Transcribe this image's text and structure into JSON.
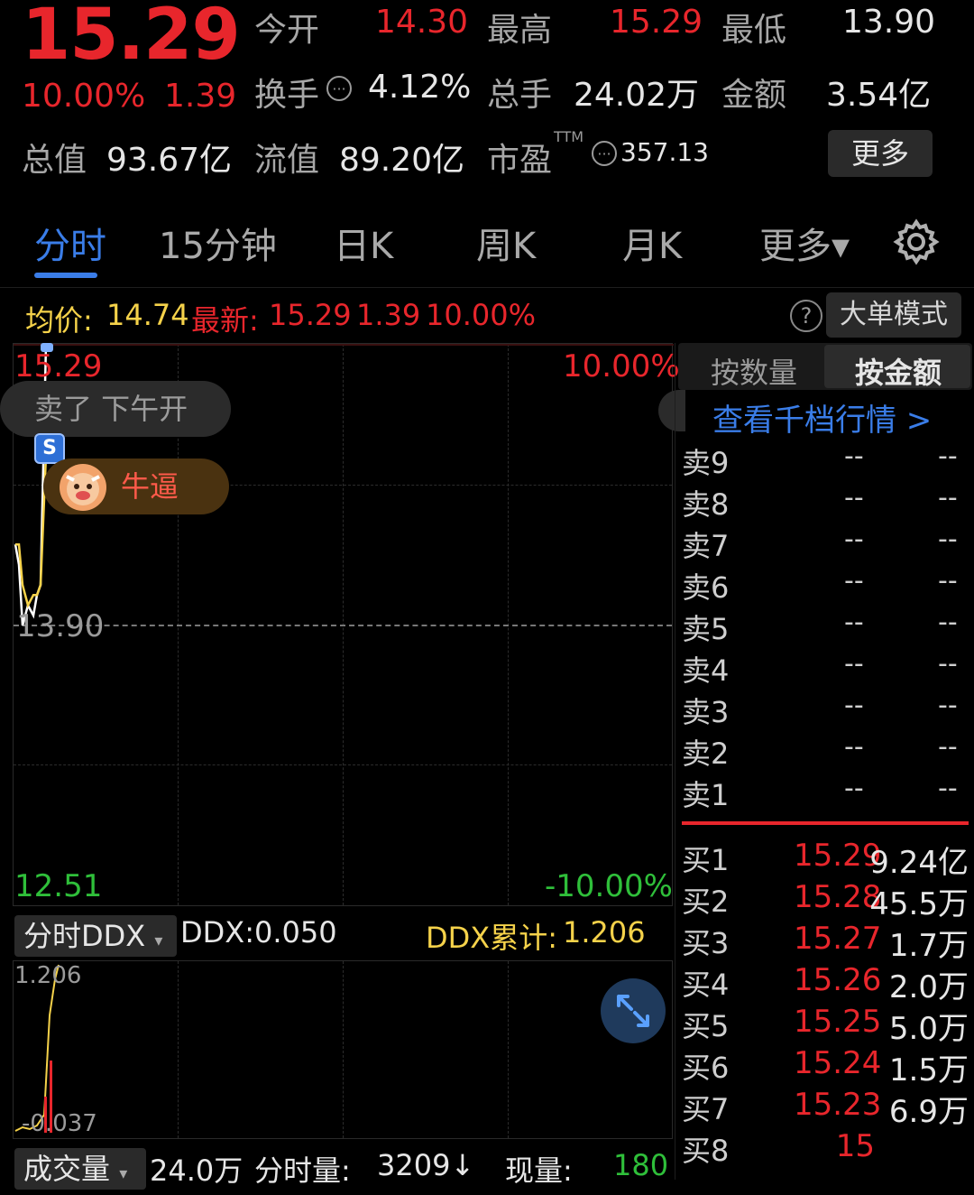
{
  "quote": {
    "price": "15.29",
    "change_pct": "10.00%",
    "change": "1.39",
    "open_label": "今开",
    "open": "14.30",
    "high_label": "最高",
    "high": "15.29",
    "low_label": "最低",
    "low": "13.90",
    "turnover_label": "换手",
    "turnover": "4.12%",
    "volume_label": "总手",
    "volume": "24.02万",
    "amount_label": "金额",
    "amount": "3.54亿",
    "mktcap_label": "总值",
    "mktcap": "93.67亿",
    "float_label": "流值",
    "float_cap": "89.20亿",
    "pe_label": "市盈",
    "pe_sup": "TTM",
    "pe": "357.13",
    "more_button": "更多"
  },
  "tabs": [
    {
      "label": "分时",
      "active": true
    },
    {
      "label": "15分钟"
    },
    {
      "label": "日K"
    },
    {
      "label": "周K"
    },
    {
      "label": "月K"
    },
    {
      "label": "更多▾"
    }
  ],
  "avg_row": {
    "avg_label": "均价:",
    "avg_value": "14.74",
    "latest_label": "最新:",
    "latest_price": "15.29",
    "latest_change": "1.39",
    "latest_pct": "10.00%",
    "mode_button": "大单模式"
  },
  "chart": {
    "y_top": "15.29",
    "y_mid": "13.90",
    "y_bottom": "12.51",
    "pct_top": "10.00%",
    "pct_bottom": "-10.00%",
    "bubble_sell": "卖了 下午开",
    "badge": "S",
    "bubble_cow": "牛逼",
    "colors": {
      "price_line": "#ffffff",
      "avg_line": "#f5d24a"
    }
  },
  "chart_data": {
    "type": "line",
    "ylim": [
      12.51,
      15.29
    ],
    "series": [
      {
        "values": [
          14.3,
          14.2,
          13.9,
          14.0,
          13.95,
          14.05,
          14.1,
          15.29,
          15.29
        ]
      },
      {
        "values": [
          14.3,
          14.3,
          14.1,
          14.0,
          14.05,
          14.05,
          14.1,
          14.74,
          15.0
        ]
      }
    ]
  },
  "ddx": {
    "selector": "分时DDX",
    "ddx_label": "DDX:",
    "ddx_value": "0.050",
    "ddx_sum_label": "DDX累计:",
    "ddx_sum_value": "1.206",
    "y_top": "1.206",
    "y_bottom": "-0.037"
  },
  "volume": {
    "selector": "成交量",
    "total": "24.0万",
    "tick_label": "分时量:",
    "tick_value": "3209↓",
    "current_label": "现量:",
    "current_value": "180"
  },
  "orderbook": {
    "tab_count": "按数量",
    "tab_amount": "按金额",
    "link": "查看千档行情 >",
    "asks": [
      {
        "label": "卖9",
        "price": "--",
        "amount": "--"
      },
      {
        "label": "卖8",
        "price": "--",
        "amount": "--"
      },
      {
        "label": "卖7",
        "price": "--",
        "amount": "--"
      },
      {
        "label": "卖6",
        "price": "--",
        "amount": "--"
      },
      {
        "label": "卖5",
        "price": "--",
        "amount": "--"
      },
      {
        "label": "卖4",
        "price": "--",
        "amount": "--"
      },
      {
        "label": "卖3",
        "price": "--",
        "amount": "--"
      },
      {
        "label": "卖2",
        "price": "--",
        "amount": "--"
      },
      {
        "label": "卖1",
        "price": "--",
        "amount": "--"
      }
    ],
    "bids": [
      {
        "label": "买1",
        "price": "15.29",
        "amount": "9.24亿"
      },
      {
        "label": "买2",
        "price": "15.28",
        "amount": "45.5万"
      },
      {
        "label": "买3",
        "price": "15.27",
        "amount": "1.7万"
      },
      {
        "label": "买4",
        "price": "15.26",
        "amount": "2.0万"
      },
      {
        "label": "买5",
        "price": "15.25",
        "amount": "5.0万"
      },
      {
        "label": "买6",
        "price": "15.24",
        "amount": "1.5万"
      },
      {
        "label": "买7",
        "price": "15.23",
        "amount": "6.9万"
      },
      {
        "label": "买8",
        "price": "15",
        "amount": ""
      }
    ]
  }
}
